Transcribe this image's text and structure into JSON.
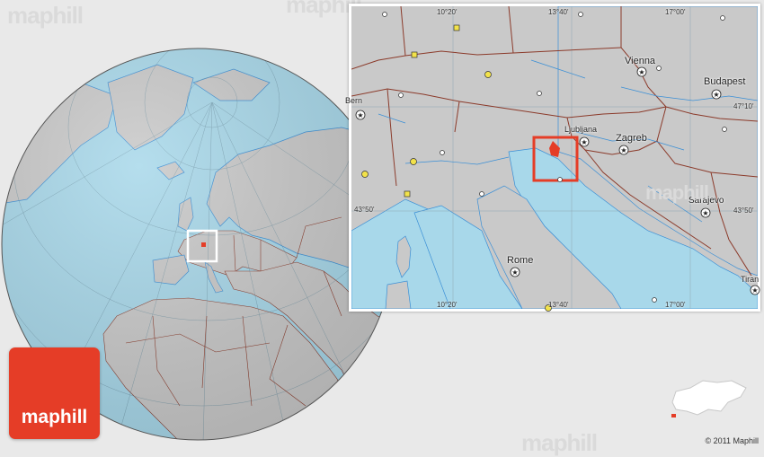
{
  "watermark": "maphill",
  "logo": {
    "text": "maphill"
  },
  "copyright": "© 2011 Maphill",
  "colors": {
    "sea": "#a8d8ea",
    "land": "#c9c9c9",
    "border": "#8b3a2a",
    "water_lines": "#3a8fd6",
    "highlight": "#e53d27",
    "background": "#e9e9e9"
  },
  "inset_map": {
    "cities": [
      {
        "name": "Vienna",
        "symbol": "star-circle"
      },
      {
        "name": "Budapest",
        "symbol": "star-circle"
      },
      {
        "name": "Bern",
        "symbol": "star-circle"
      },
      {
        "name": "Ljubljana",
        "symbol": "star-circle"
      },
      {
        "name": "Zagreb",
        "symbol": "star-circle"
      },
      {
        "name": "Sarajevo",
        "symbol": "star-circle"
      },
      {
        "name": "Rome",
        "symbol": "star-circle"
      },
      {
        "name": "Tiran",
        "symbol": "star-circle"
      }
    ],
    "coordinates": {
      "top": [
        "10°20'",
        "13°40'",
        "17°00'"
      ],
      "bottom": [
        "10°20'",
        "13°40'",
        "17°00'"
      ],
      "left": [
        "43°50'"
      ],
      "right": [
        "47°10'",
        "43°50'"
      ]
    }
  }
}
